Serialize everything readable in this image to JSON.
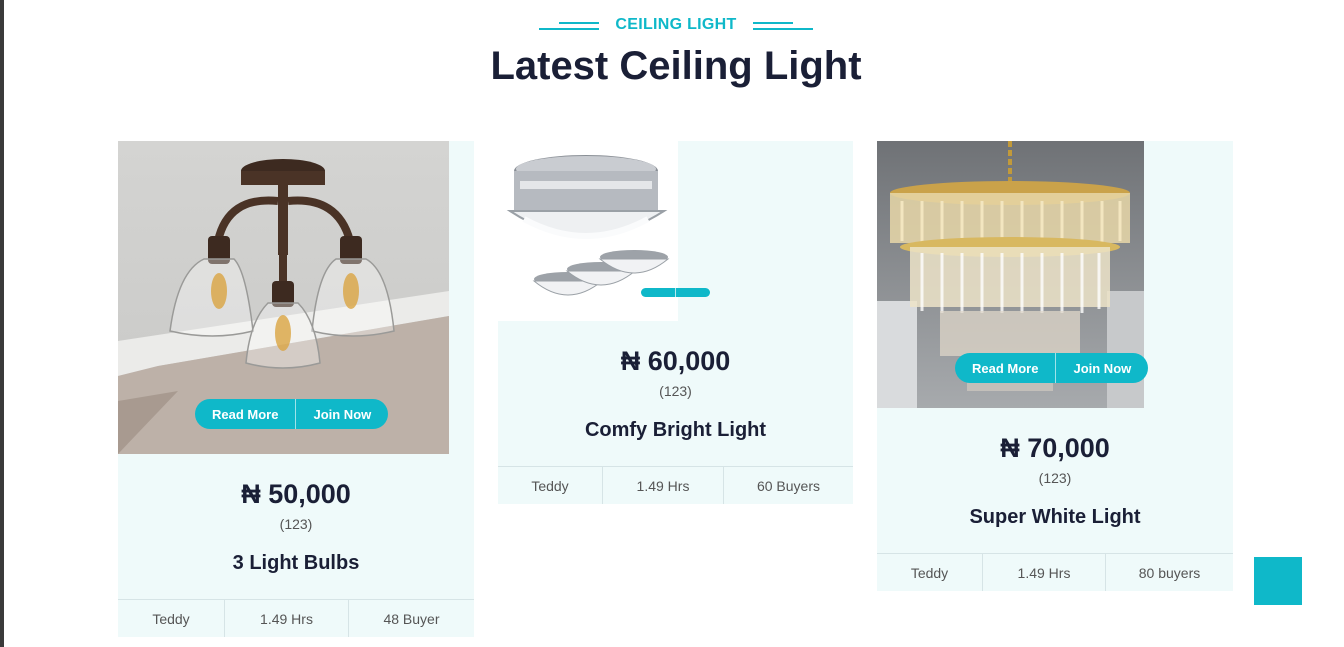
{
  "section": {
    "subtitle": "CEILING LIGHT",
    "title": "Latest Ceiling Light"
  },
  "buttons": {
    "read_more": "Read More",
    "join_now": "Join Now"
  },
  "products": [
    {
      "price": "₦ 50,000",
      "rating": "(123)",
      "name": "3 Light Bulbs",
      "author": "Teddy",
      "duration": "1.49 Hrs",
      "buyers": "48 Buyer",
      "image_icon": "ceiling-light-3-bulb-icon"
    },
    {
      "price": "₦ 60,000",
      "rating": "(123)",
      "name": "Comfy Bright Light",
      "author": "Teddy",
      "duration": "1.49 Hrs",
      "buyers": "60 Buyers",
      "image_icon": "flush-mount-light-icon"
    },
    {
      "price": "₦ 70,000",
      "rating": "(123)",
      "name": "Super White Light",
      "author": "Teddy",
      "duration": "1.49 Hrs",
      "buyers": "80 buyers",
      "image_icon": "crystal-chandelier-icon"
    }
  ],
  "colors": {
    "accent": "#0fb8c9",
    "heading": "#1a1f36",
    "card_bg": "#effafa"
  },
  "scroll_top_icon": "scroll-to-top-icon"
}
